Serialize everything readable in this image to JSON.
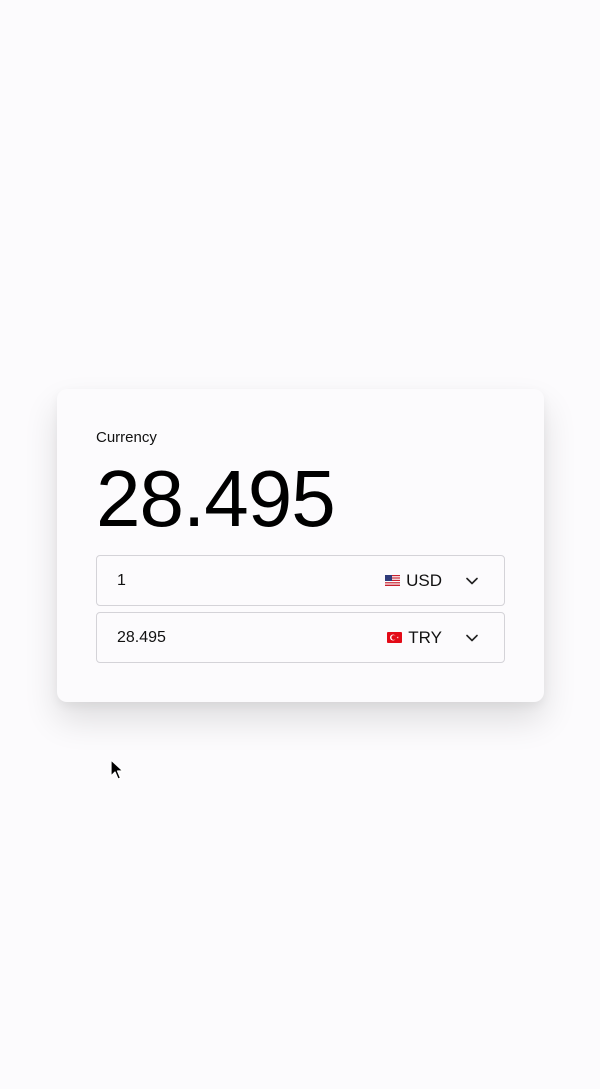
{
  "converter": {
    "label": "Currency",
    "result": "28.495",
    "from": {
      "amount": "1",
      "currency_code": "USD",
      "flag_icon": "us-flag-icon"
    },
    "to": {
      "amount": "28.495",
      "currency_code": "TRY",
      "flag_icon": "tr-flag-icon"
    }
  },
  "colors": {
    "background": "#fcfbfd",
    "border": "#d4d3d8",
    "text": "#111111"
  }
}
